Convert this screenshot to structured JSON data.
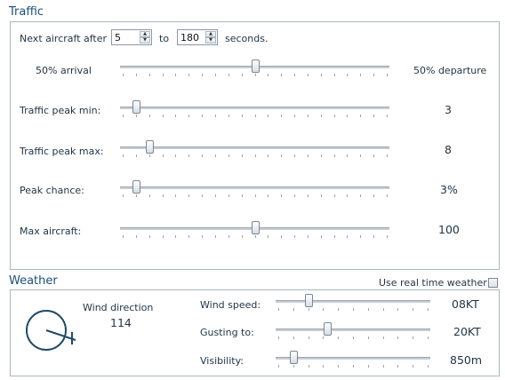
{
  "traffic": {
    "title": "Traffic",
    "next_aircraft_label": "Next aircraft after",
    "min_seconds": "5",
    "to_label": "to",
    "max_seconds": "180",
    "seconds_label": "seconds.",
    "arrival_label": "50% arrival",
    "departure_label": "50% departure",
    "arrival_departure_fraction": 0.5,
    "peak_min_label": "Traffic peak min:",
    "peak_min_value": "3",
    "peak_min_fraction": 0.05,
    "peak_max_label": "Traffic peak max:",
    "peak_max_value": "8",
    "peak_max_fraction": 0.1,
    "peak_chance_label": "Peak chance:",
    "peak_chance_value": "3%",
    "peak_chance_fraction": 0.05,
    "max_aircraft_label": "Max aircraft:",
    "max_aircraft_value": "100",
    "max_aircraft_fraction": 0.5
  },
  "weather": {
    "title": "Weather",
    "real_time_label": "Use real time weather",
    "real_time_checked": false,
    "wind_direction_label": "Wind direction",
    "wind_direction_value": "114",
    "wind_speed_label": "Wind speed:",
    "wind_speed_value": "08KT",
    "wind_speed_fraction": 0.2,
    "gusting_label": "Gusting to:",
    "gusting_value": "20KT",
    "gusting_fraction": 0.33,
    "visibility_label": "Visibility:",
    "visibility_value": "850m",
    "visibility_fraction": 0.1
  },
  "colors": {
    "title_blue": "#1d4f78",
    "border": "#a9b6c2",
    "compass": "#1e4a66"
  }
}
